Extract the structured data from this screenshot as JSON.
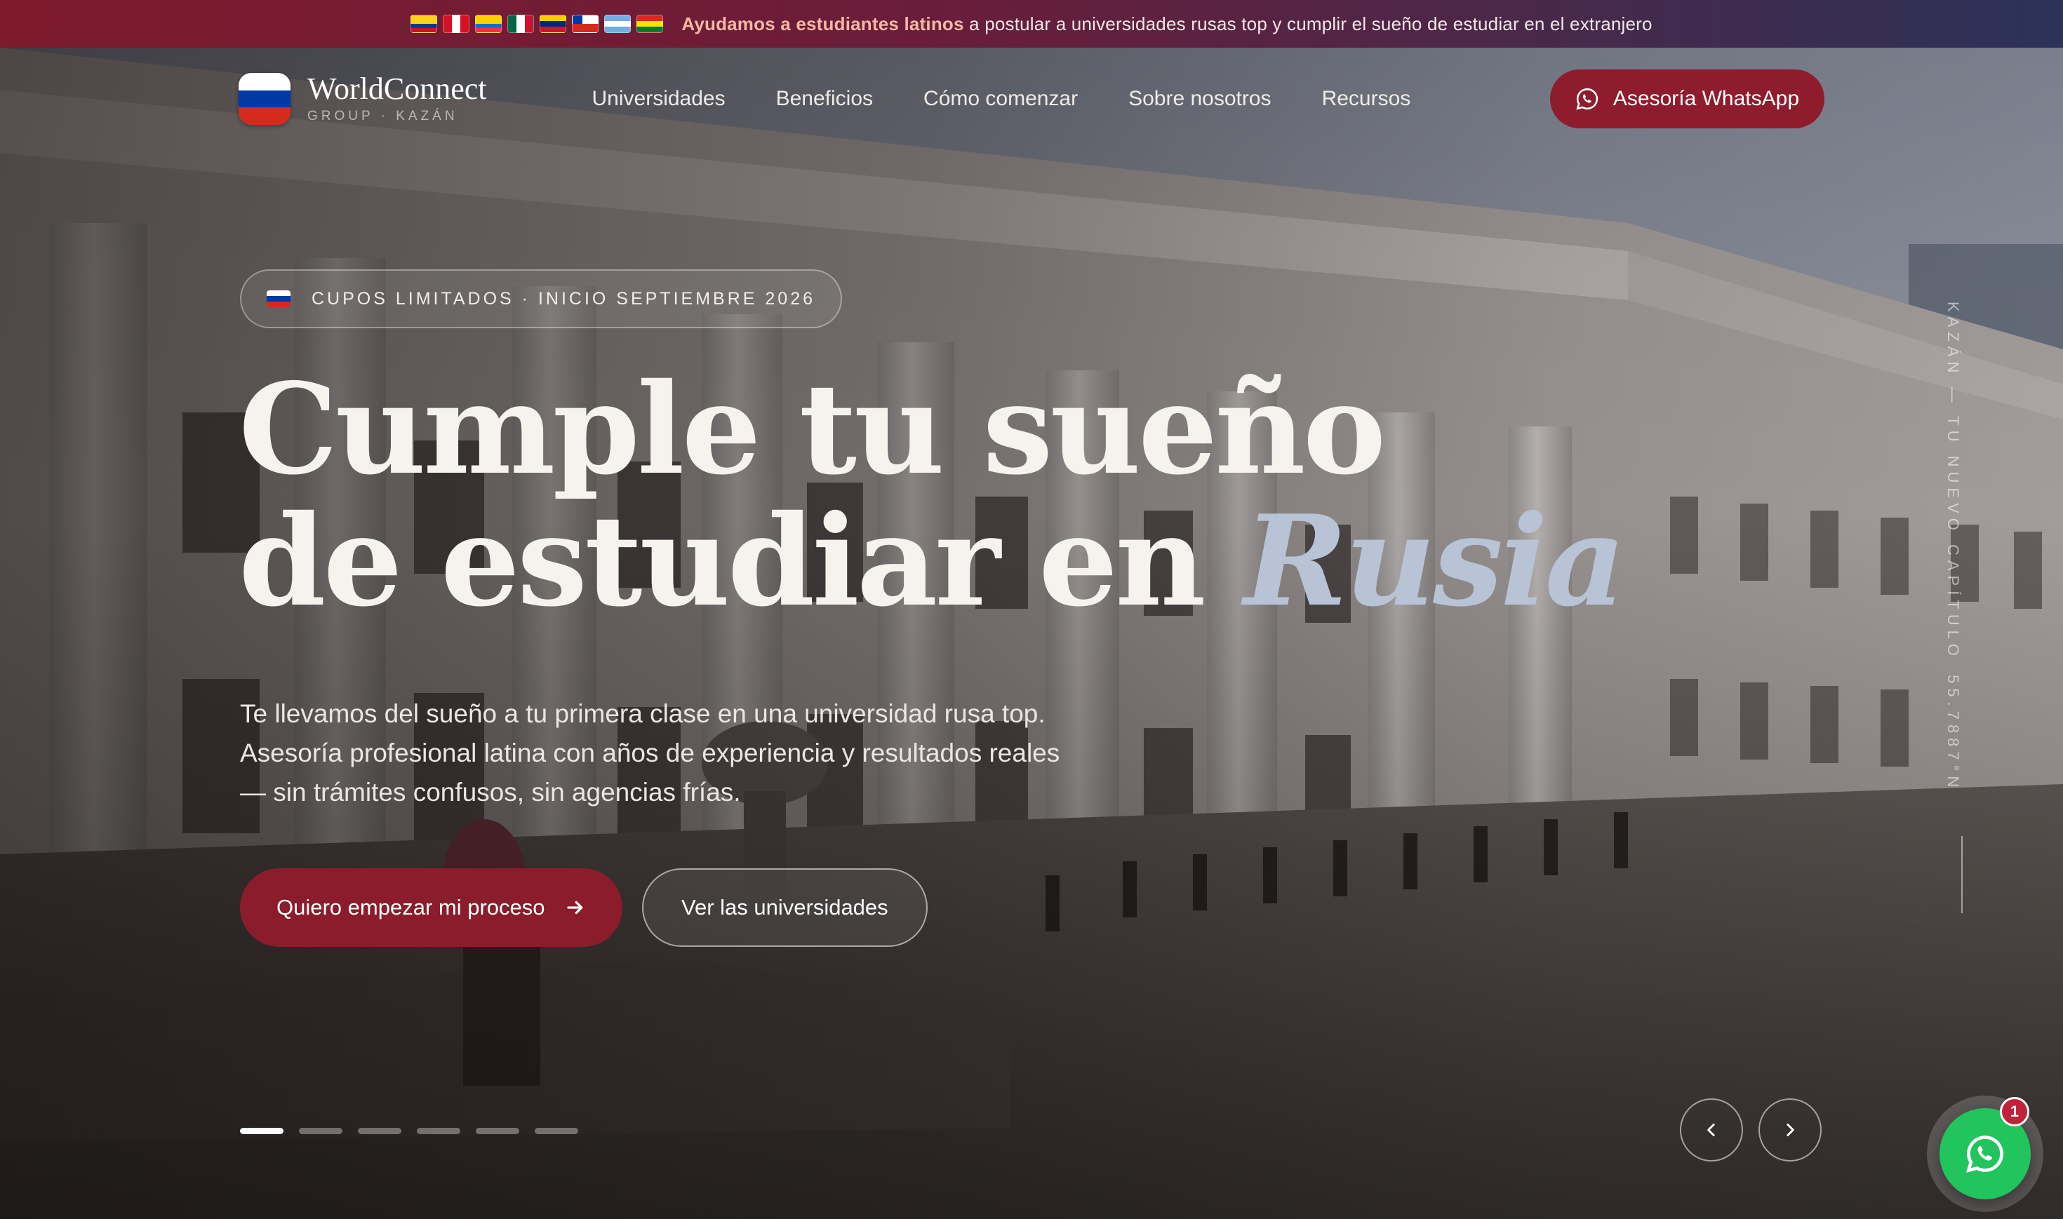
{
  "announcement": {
    "flags": [
      {
        "name": "colombia-flag-icon",
        "colors": [
          "#fcd116",
          "#fcd116",
          "#003893",
          "#ce1126"
        ],
        "dir": "h"
      },
      {
        "name": "peru-flag-icon",
        "colors": [
          "#d91023",
          "#ffffff",
          "#d91023"
        ],
        "dir": "v"
      },
      {
        "name": "ecuador-flag-icon",
        "colors": [
          "#ffd100",
          "#ffd100",
          "#0072ce",
          "#ef3340"
        ],
        "dir": "h"
      },
      {
        "name": "mexico-flag-icon",
        "colors": [
          "#006847",
          "#ffffff",
          "#ce1126"
        ],
        "dir": "v"
      },
      {
        "name": "venezuela-flag-icon",
        "colors": [
          "#ffcc00",
          "#00247d",
          "#cf142b"
        ],
        "dir": "h"
      },
      {
        "name": "chile-flag-icon",
        "colors": [
          "#0039a6",
          "#ffffff",
          "#d52b1e"
        ],
        "dir": "chile"
      },
      {
        "name": "argentina-flag-icon",
        "colors": [
          "#74acdf",
          "#ffffff",
          "#74acdf"
        ],
        "dir": "h"
      },
      {
        "name": "bolivia-flag-icon",
        "colors": [
          "#d52b1e",
          "#f9e300",
          "#007934"
        ],
        "dir": "h"
      }
    ],
    "highlight": "Ayudamos a estudiantes latinos",
    "text": " a postular a universidades rusas top y cumplir el sueño de estudiar en el extranjero"
  },
  "brand": {
    "name": "WorldConnect",
    "tagline": "GROUP · KAZÁN"
  },
  "nav": {
    "items": [
      {
        "label": "Universidades"
      },
      {
        "label": "Beneficios"
      },
      {
        "label": "Cómo comenzar"
      },
      {
        "label": "Sobre nosotros"
      },
      {
        "label": "Recursos"
      }
    ],
    "cta_label": "Asesoría WhatsApp"
  },
  "hero": {
    "badge": "CUPOS LIMITADOS · INICIO SEPTIEMBRE 2026",
    "headline_line1": "Cumple tu sueño",
    "headline_line2": "de estudiar en ",
    "headline_accent": "Rusia",
    "lead": "Te llevamos del sueño a tu primera clase en una universidad rusa top. Asesoría profesional latina con años de experiencia y resultados reales — sin trámites confusos, sin agencias frías.",
    "primary_cta": "Quiero empezar mi proceso",
    "secondary_cta": "Ver las universidades",
    "vertical_caption_a": "KAZÁN — TU NUEVO CAPÍTULO",
    "vertical_caption_b": "55.7887°N",
    "slides_total": 6,
    "slide_active_index": 0
  },
  "whatsapp_float": {
    "badge_count": "1"
  },
  "colors": {
    "accent": "#8a1c2b",
    "whatsapp": "#22c45e",
    "headline_accent": "#b8c3d6"
  }
}
